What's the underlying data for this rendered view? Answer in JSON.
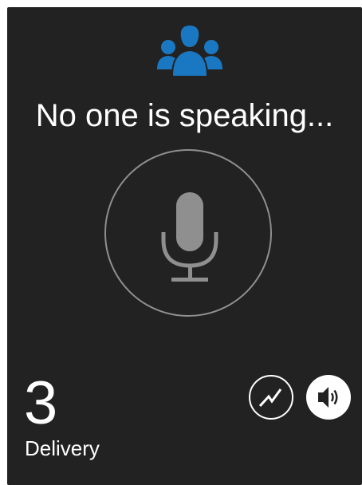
{
  "status": {
    "text": "No one is speaking..."
  },
  "channel": {
    "number": "3",
    "name": "Delivery"
  },
  "icons": {
    "group": "group-icon",
    "microphone": "microphone-icon",
    "activity": "activity-icon",
    "speaker": "speaker-icon"
  },
  "colors": {
    "background": "#222222",
    "accent_blue": "#1a78c2",
    "mic_gray": "#8f8f8f",
    "text": "#ffffff"
  }
}
